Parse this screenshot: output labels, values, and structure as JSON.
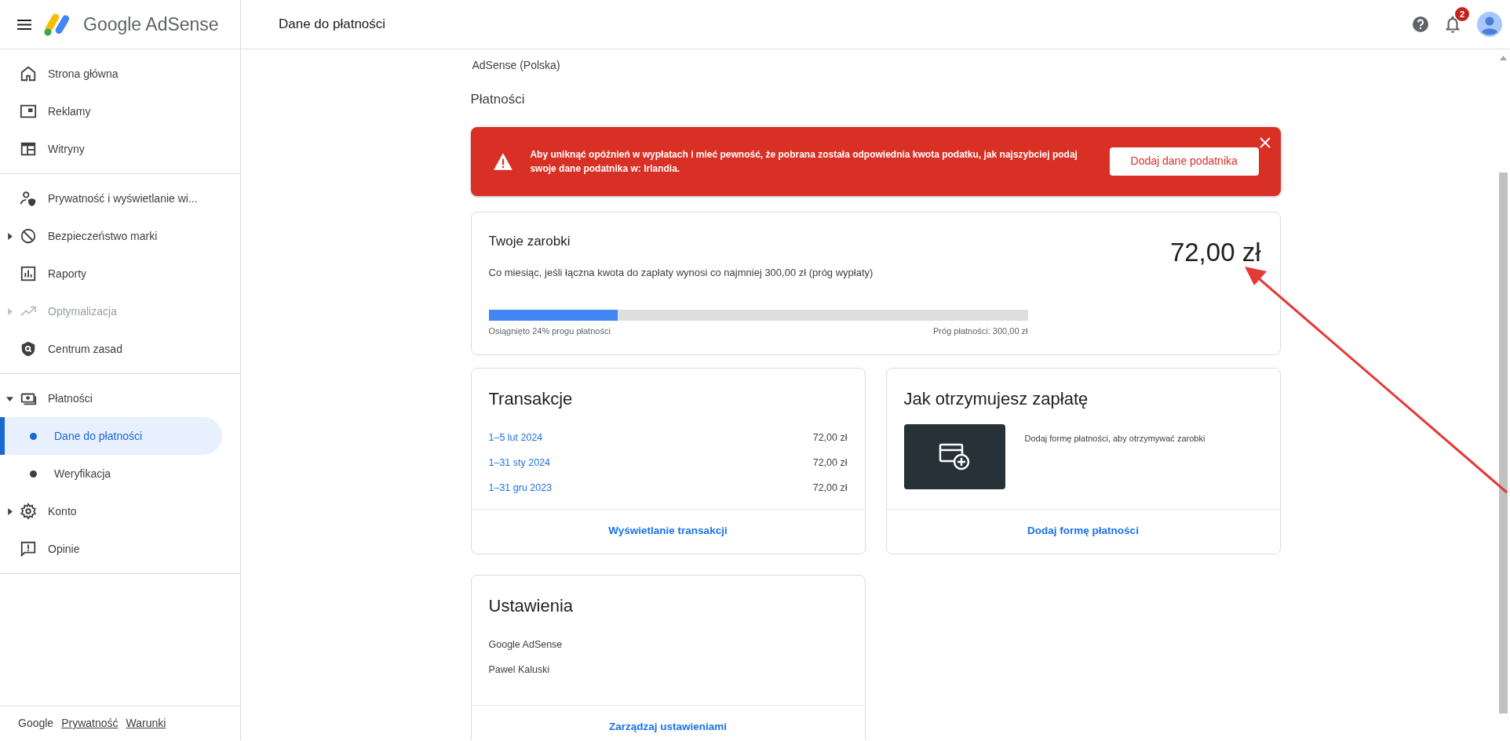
{
  "header": {
    "app_name": "Google AdSense",
    "page_title": "Dane do płatności",
    "notification_count": "2"
  },
  "sidebar": {
    "groups": [
      [
        {
          "label": "Strona główna",
          "disabled": false
        },
        {
          "label": "Reklamy",
          "disabled": false
        },
        {
          "label": "Witryny",
          "disabled": false
        }
      ],
      [
        {
          "label": "Prywatność i wyświetlanie wi...",
          "disabled": false
        },
        {
          "label": "Bezpieczeństwo marki",
          "expanded": false,
          "disabled": false
        },
        {
          "label": "Raporty",
          "disabled": false
        },
        {
          "label": "Optymalizacja",
          "expanded": false,
          "disabled": true
        },
        {
          "label": "Centrum zasad",
          "disabled": false
        }
      ],
      [
        {
          "label": "Płatności",
          "expanded": true,
          "disabled": false,
          "children": [
            {
              "label": "Dane do płatności",
              "selected": true
            },
            {
              "label": "Weryfikacja",
              "selected": false
            }
          ]
        },
        {
          "label": "Konto",
          "expanded": false,
          "disabled": false
        },
        {
          "label": "Opinie",
          "disabled": false
        }
      ]
    ],
    "footer": {
      "brand": "Google",
      "links": [
        "Prywatność",
        "Warunki"
      ]
    }
  },
  "content": {
    "account_name": "AdSense (Polska)",
    "section_title": "Płatności",
    "alert": {
      "message": "Aby uniknąć opóźnień w wypłatach i mieć pewność, że pobrana została odpowiednia kwota podatku, jak najszybciej podaj swoje dane podatnika w: Irlandia.",
      "button": "Dodaj dane podatnika"
    },
    "earnings": {
      "title": "Twoje zarobki",
      "amount": "72,00 zł",
      "description": "Co miesiąc, jeśli łączna kwota do zapłaty wynosi co najmniej 300,00 zł (próg wypłaty)",
      "progress": {
        "level": 0.24,
        "left_label": "Osiągnięto 24% progu płatności",
        "right_label": "Próg płatności: 300,00 zł"
      }
    },
    "transactions": {
      "title": "Transakcje",
      "rows": [
        {
          "period": "1–5 lut 2024",
          "amount": "72,00 zł"
        },
        {
          "period": "1–31 sty 2024",
          "amount": "72,00 zł"
        },
        {
          "period": "1–31 gru 2023",
          "amount": "72,00 zł"
        }
      ],
      "link": "Wyświetlanie transakcji"
    },
    "payment_method": {
      "title": "Jak otrzymujesz zapłatę",
      "text": "Dodaj formę płatności, aby otrzymywać zarobki",
      "link": "Dodaj formę płatności"
    },
    "settings": {
      "title": "Ustawienia",
      "lines": [
        "Google AdSense",
        "Pawel Kaluski"
      ],
      "link": "Zarządzaj ustawieniami"
    }
  }
}
